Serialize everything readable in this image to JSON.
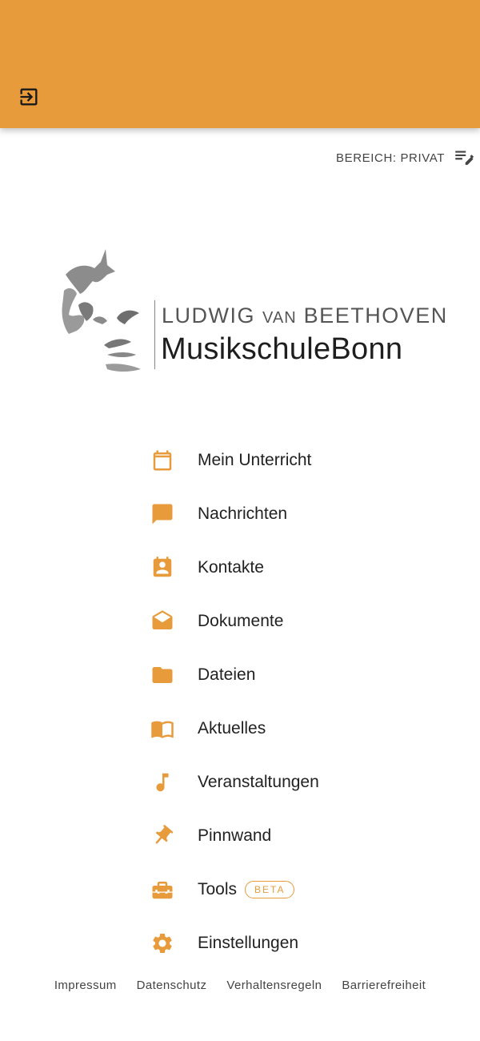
{
  "colors": {
    "accent": "#E79B3B",
    "text": "#222222"
  },
  "appbar": {
    "logout_icon": "logout-icon"
  },
  "area": {
    "label": "BEREICH: PRIVAT",
    "icon": "edit-list-icon"
  },
  "logo": {
    "line1_a": "LUDWIG",
    "line1_b": "VAN",
    "line1_c": "BEETHOVEN",
    "line2_a": "Musikschule",
    "line2_b": "Bonn"
  },
  "menu": [
    {
      "label": "Mein Unterricht",
      "icon": "calendar-icon"
    },
    {
      "label": "Nachrichten",
      "icon": "chat-bubble-icon"
    },
    {
      "label": "Kontakte",
      "icon": "contact-card-icon"
    },
    {
      "label": "Dokumente",
      "icon": "open-envelope-icon"
    },
    {
      "label": "Dateien",
      "icon": "folder-icon"
    },
    {
      "label": "Aktuelles",
      "icon": "book-icon"
    },
    {
      "label": "Veranstaltungen",
      "icon": "music-note-icon"
    },
    {
      "label": "Pinnwand",
      "icon": "pin-icon"
    },
    {
      "label": "Tools",
      "icon": "toolbox-icon",
      "badge": "BETA"
    },
    {
      "label": "Einstellungen",
      "icon": "gear-icon"
    }
  ],
  "footer": {
    "impressum": "Impressum",
    "datenschutz": "Datenschutz",
    "verhaltensregeln": "Verhaltensregeln",
    "barrierefreiheit": "Barrierefreiheit"
  }
}
